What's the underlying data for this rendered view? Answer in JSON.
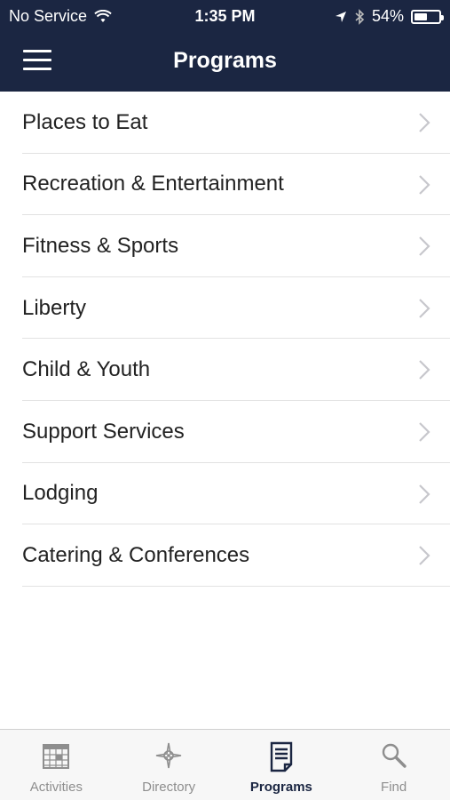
{
  "status_bar": {
    "carrier": "No Service",
    "time": "1:35 PM",
    "battery": "54%",
    "battery_level": 0.54
  },
  "header": {
    "title": "Programs"
  },
  "programs": [
    "Places to Eat",
    "Recreation & Entertainment",
    "Fitness & Sports",
    "Liberty",
    "Child & Youth",
    "Support Services",
    "Lodging",
    "Catering & Conferences"
  ],
  "tabs": [
    {
      "label": "Activities",
      "icon": "calendar-icon"
    },
    {
      "label": "Directory",
      "icon": "compass-icon"
    },
    {
      "label": "Programs",
      "icon": "document-icon",
      "active": true
    },
    {
      "label": "Find",
      "icon": "search-icon"
    }
  ],
  "colors": {
    "header_bg": "#1b2642",
    "inactive_tab": "#8e8e8e",
    "active_tab": "#1b2642"
  }
}
